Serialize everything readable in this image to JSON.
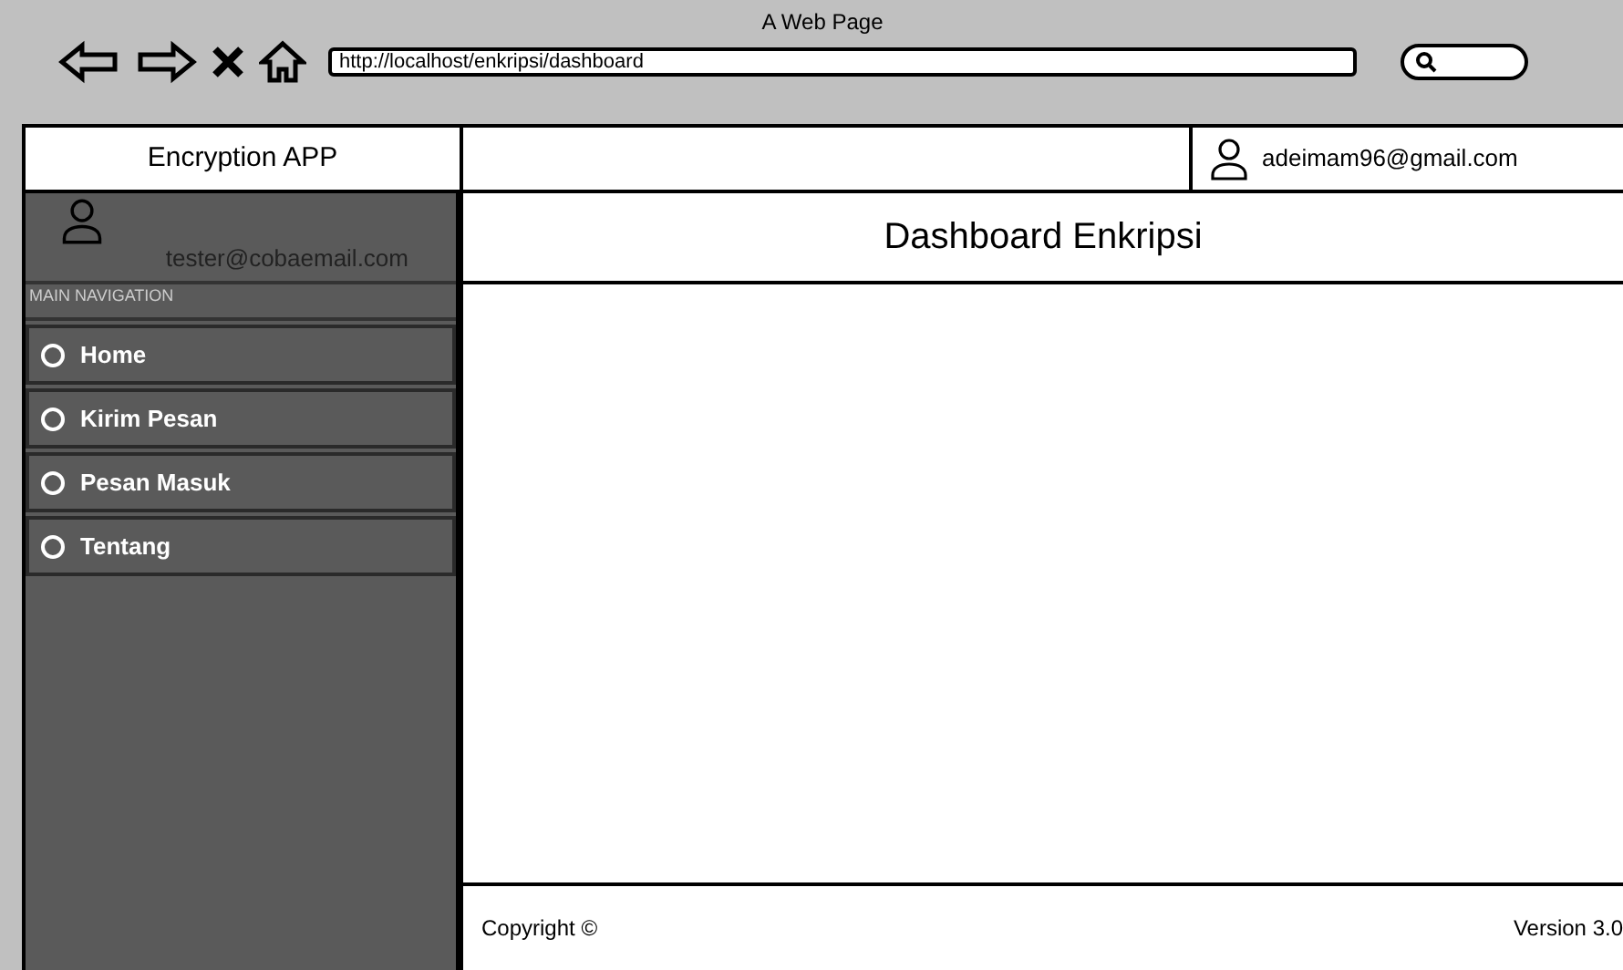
{
  "window": {
    "title": "A Web Page",
    "url": "http://localhost/enkripsi/dashboard"
  },
  "header": {
    "app_name": "Encryption APP",
    "user_email": "adeimam96@gmail.com"
  },
  "sidebar": {
    "user_email": "tester@cobaemail.com",
    "section_label": "MAIN NAVIGATION",
    "items": [
      {
        "label": "Home"
      },
      {
        "label": "Kirim Pesan"
      },
      {
        "label": "Pesan Masuk"
      },
      {
        "label": "Tentang"
      }
    ]
  },
  "content": {
    "title": "Dashboard Enkripsi"
  },
  "footer": {
    "copyright": "Copyright ©",
    "version": "Version 3.0"
  }
}
